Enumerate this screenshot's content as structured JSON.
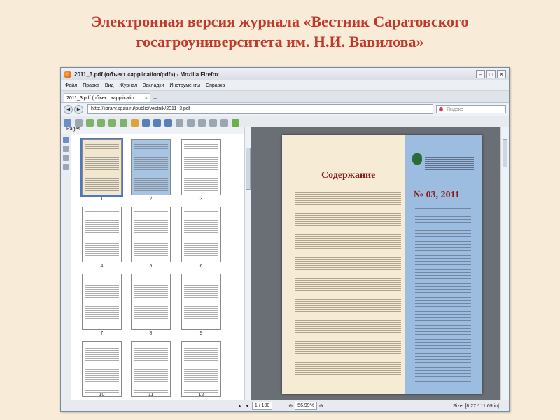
{
  "slide": {
    "title_line1": "Электронная версия журнала «Вестник Саратовского",
    "title_line2": "госагроуниверситета им. Н.И. Вавилова»"
  },
  "window": {
    "title": "2011_3.pdf (объект «application/pdf») - Mozilla Firefox",
    "menu": [
      "Файл",
      "Правка",
      "Вид",
      "Журнал",
      "Закладки",
      "Инструменты",
      "Справка"
    ],
    "tab_label": "2011_3.pdf (объект «applicatio...",
    "url": "http://library.sgau.ru/public/vestnik/2011_3.pdf",
    "search_placeholder": "Яндекс"
  },
  "viewer": {
    "pages_label": "Pages",
    "thumb_labels": [
      "1",
      "2",
      "3",
      "4",
      "5",
      "6",
      "7",
      "8",
      "9",
      "10",
      "11",
      "12"
    ],
    "page_title": "Содержание",
    "issue": "№ 03, 2011",
    "page_indicator": "1 / 100",
    "zoom": "56.99%",
    "size_label": "Size: [8.27 * 11.69 in]"
  },
  "colors": {
    "title_red": "#c0392b",
    "page_blue": "#9dbde0",
    "page_cream": "#f6ecd6"
  }
}
